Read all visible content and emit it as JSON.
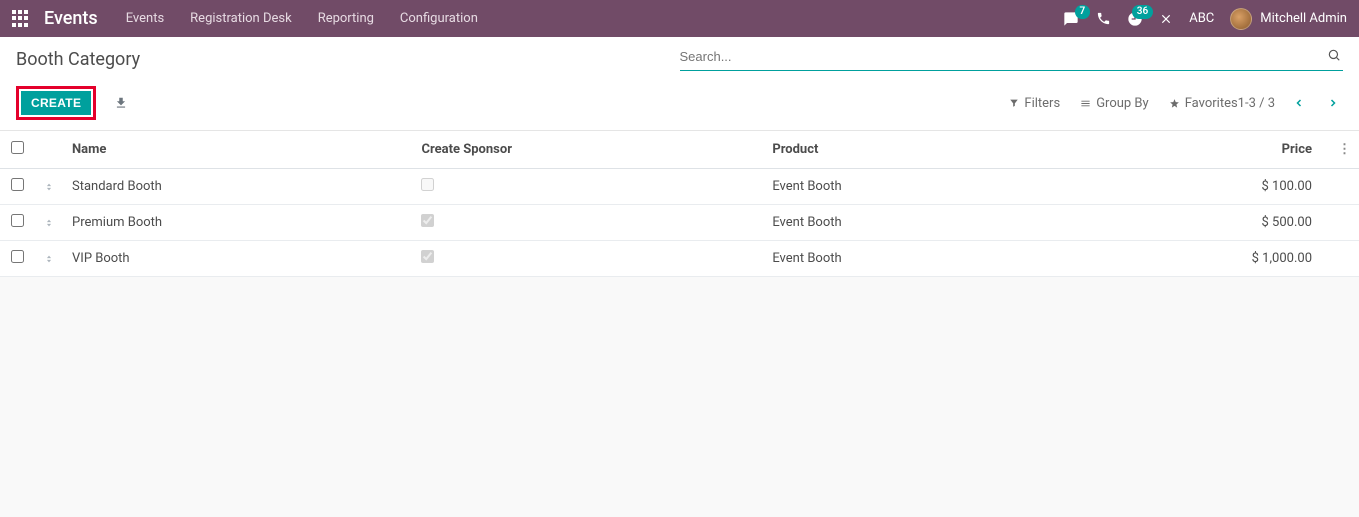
{
  "topbar": {
    "brand": "Events",
    "nav": [
      "Events",
      "Registration Desk",
      "Reporting",
      "Configuration"
    ],
    "chat_badge": "7",
    "activity_badge": "36",
    "company": "ABC",
    "user": "Mitchell Admin"
  },
  "control": {
    "title": "Booth Category",
    "search_placeholder": "Search...",
    "create_label": "CREATE",
    "filters_label": "Filters",
    "groupby_label": "Group By",
    "favorites_label": "Favorites",
    "pager": "1-3 / 3"
  },
  "columns": {
    "name": "Name",
    "create_sponsor": "Create Sponsor",
    "product": "Product",
    "price": "Price"
  },
  "rows": [
    {
      "name": "Standard Booth",
      "create_sponsor": false,
      "product": "Event Booth",
      "price": "$ 100.00"
    },
    {
      "name": "Premium Booth",
      "create_sponsor": true,
      "product": "Event Booth",
      "price": "$ 500.00"
    },
    {
      "name": "VIP Booth",
      "create_sponsor": true,
      "product": "Event Booth",
      "price": "$ 1,000.00"
    }
  ]
}
